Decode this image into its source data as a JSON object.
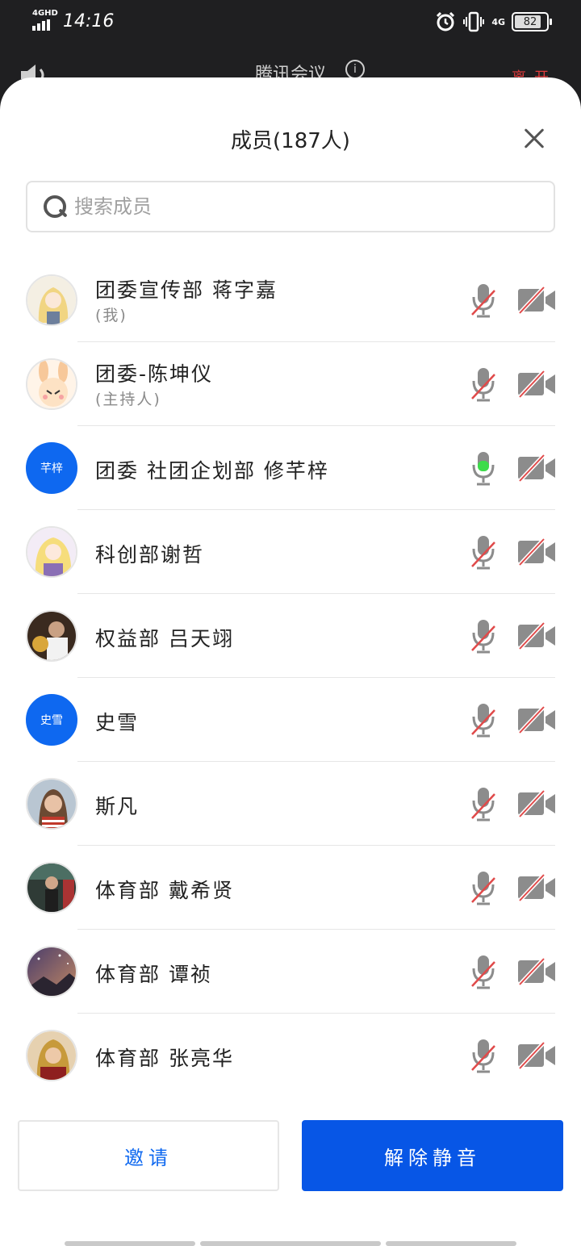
{
  "status_bar": {
    "network_left": "4GHD",
    "time": "14:16",
    "network_right": "4G",
    "battery": "82"
  },
  "app_bar": {
    "title": "腾讯会议",
    "end_label": "离开"
  },
  "sheet": {
    "title": "成员(187人)"
  },
  "search": {
    "placeholder": "搜索成员"
  },
  "members": [
    {
      "name": "团委宣传部  蒋字嘉",
      "sub": "(我)",
      "avatar": "anime-blonde",
      "mic": "muted",
      "camera": "off"
    },
    {
      "name": "团委-陈坤仪",
      "sub": "(主持人)",
      "avatar": "anime-bunny",
      "mic": "muted",
      "camera": "off"
    },
    {
      "name": "团委  社团企划部  修芊梓",
      "sub": "",
      "avatar_text": "芊梓",
      "mic": "active",
      "mic_level": 0.45,
      "camera": "off"
    },
    {
      "name": "科创部谢哲",
      "sub": "",
      "avatar": "anime-sailor",
      "mic": "muted",
      "camera": "off"
    },
    {
      "name": "权益部  吕天翊",
      "sub": "",
      "avatar": "photo-man",
      "mic": "muted",
      "camera": "off"
    },
    {
      "name": "史雪",
      "sub": "",
      "avatar_text": "史雪",
      "mic": "muted",
      "camera": "off"
    },
    {
      "name": "斯凡",
      "sub": "",
      "avatar": "photo-girl",
      "mic": "muted",
      "camera": "off"
    },
    {
      "name": "体育部  戴希贤",
      "sub": "",
      "avatar": "photo-street",
      "mic": "muted",
      "camera": "off"
    },
    {
      "name": "体育部  谭祯",
      "sub": "",
      "avatar": "photo-galaxy",
      "mic": "muted",
      "camera": "off"
    },
    {
      "name": "体育部  张亮华",
      "sub": "",
      "avatar": "painting-figure",
      "mic": "muted",
      "camera": "off"
    }
  ],
  "buttons": {
    "invite": "邀请",
    "unmute": "解除静音"
  },
  "colors": {
    "accent": "#0756e6",
    "mic_active": "#3ddc4a",
    "mute_slash": "#e04a4a"
  }
}
